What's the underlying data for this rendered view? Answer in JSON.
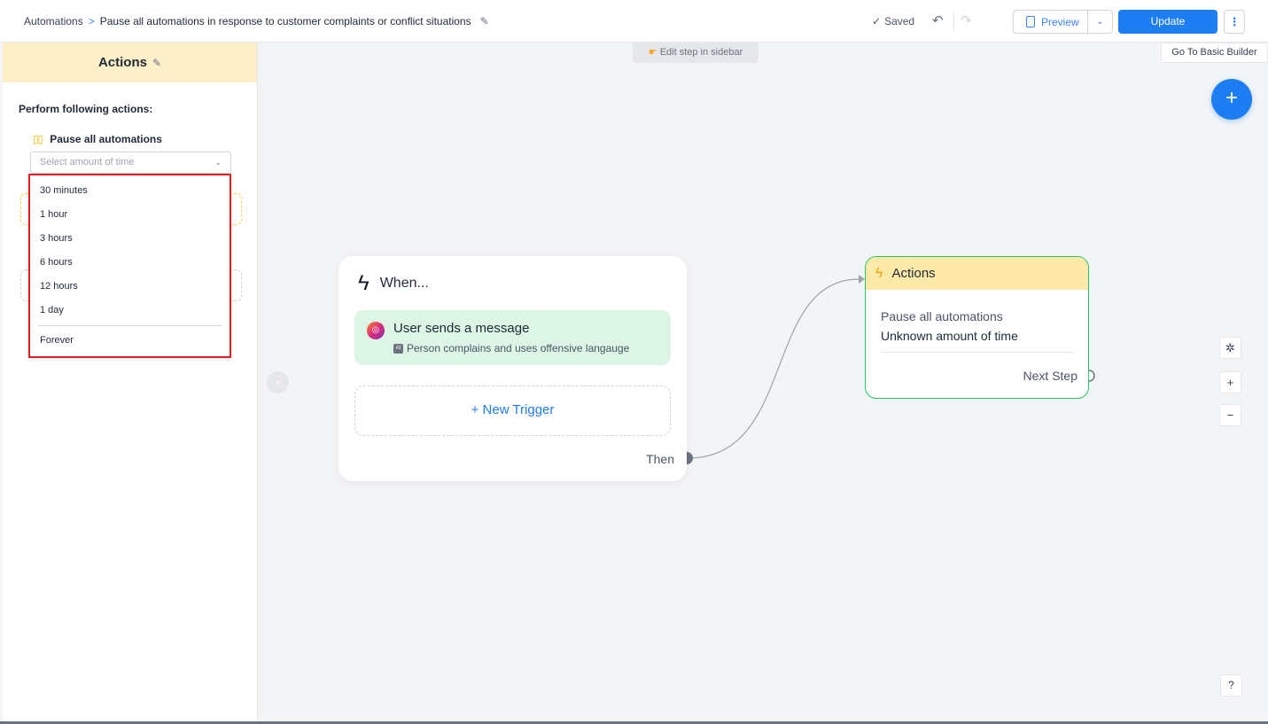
{
  "breadcrumb": {
    "root": "Automations",
    "separator": ">",
    "current": "Pause all automations in response to customer complaints or conflict situations"
  },
  "topbar": {
    "saved_label": "Saved",
    "preview_label": "Preview",
    "update_label": "Update"
  },
  "sidebar": {
    "title": "Actions",
    "perform_label": "Perform following actions:",
    "action_title": "Pause all automations",
    "select_placeholder": "Select amount of time",
    "options": [
      "30 minutes",
      "1 hour",
      "3 hours",
      "6 hours",
      "12 hours",
      "1 day"
    ],
    "forever_option": "Forever"
  },
  "canvas": {
    "hint": "Edit step in sidebar",
    "basic_builder_label": "Go To Basic Builder"
  },
  "when_card": {
    "title": "When...",
    "trigger_title": "User sends a message",
    "trigger_condition": "Person complains and uses offensive langauge",
    "new_trigger_label": "+ New Trigger",
    "then_label": "Then"
  },
  "actions_card": {
    "title": "Actions",
    "line1": "Pause all automations",
    "line2": "Unknown amount of time",
    "next_step_label": "Next Step"
  },
  "icons": [
    "pencil-icon",
    "check-icon",
    "undo-icon",
    "redo-icon",
    "phone-icon",
    "chevron-down-icon",
    "kebab-icon",
    "plus-icon",
    "chevron-left-icon",
    "magic-wand-icon",
    "zoom-in-icon",
    "zoom-out-icon",
    "help-icon",
    "bolt-icon",
    "instagram-icon",
    "pause-icon",
    "hand-pointer-icon"
  ],
  "colors": {
    "accent": "#1d7df2",
    "sidebar_header": "#fdefc7",
    "trigger_bg": "#dcf5e4",
    "actions_border": "#22c55e",
    "dropdown_highlight": "#e11d24"
  }
}
